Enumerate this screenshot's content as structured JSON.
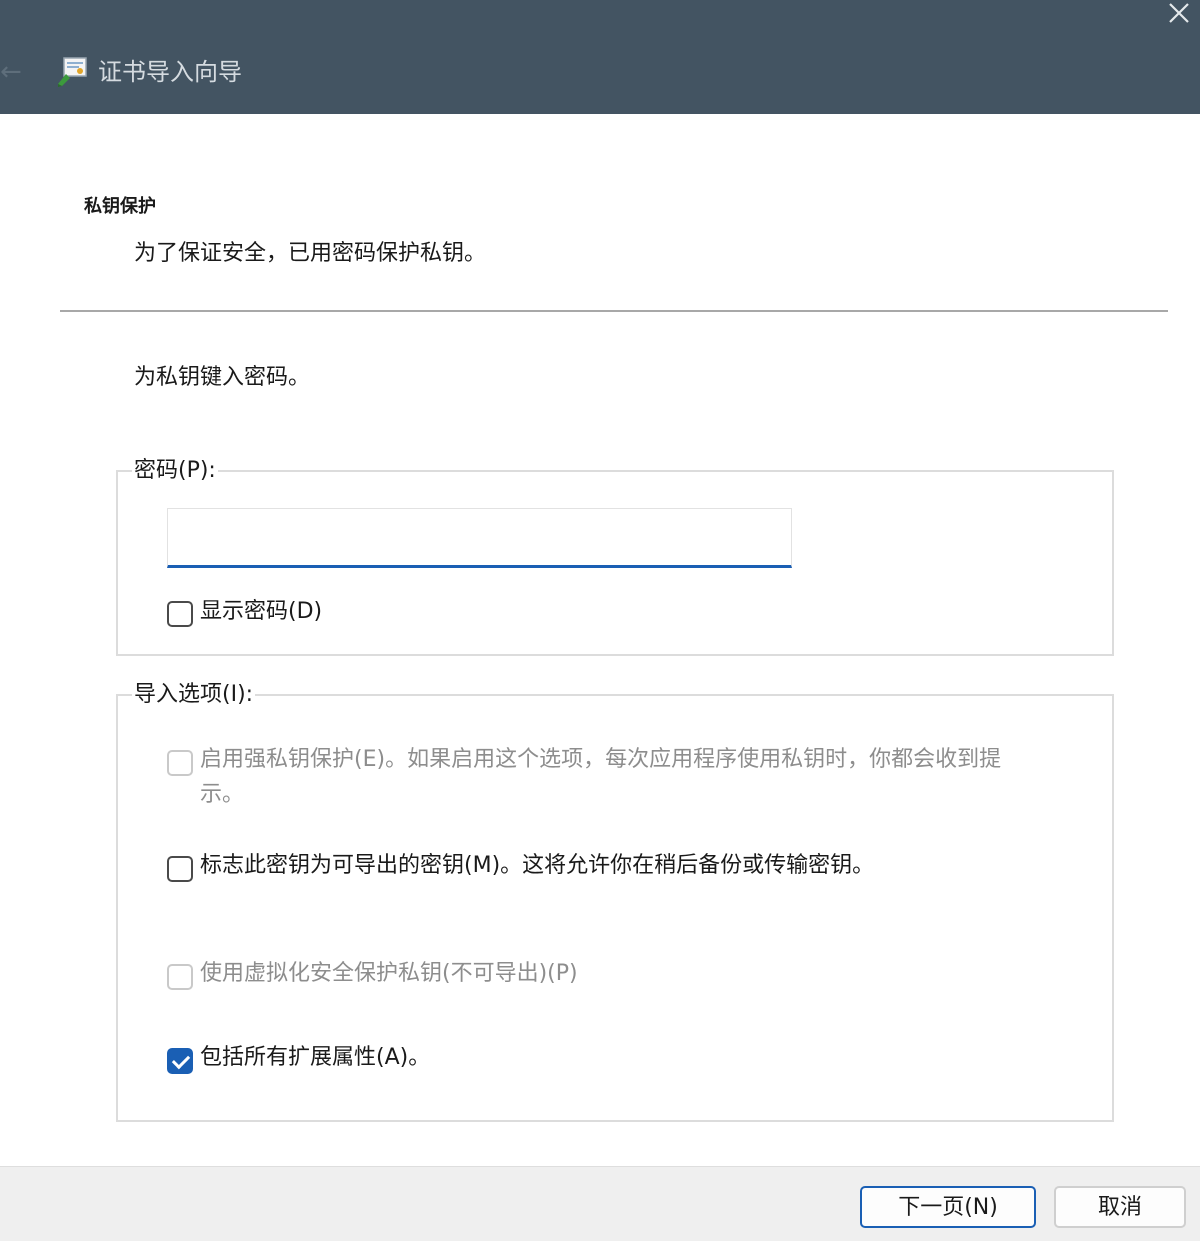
{
  "window": {
    "title": "证书导入向导",
    "back_icon": "back-arrow-icon",
    "close_icon": "close-icon",
    "app_icon": "certificate-wizard-icon"
  },
  "header": {
    "section_title": "私钥保护",
    "section_desc": "为了保证安全，已用密码保护私钥。"
  },
  "main": {
    "prompt": "为私钥键入密码。",
    "password_group": {
      "legend": "密码(P):",
      "password_value": "",
      "show_password": {
        "label": "显示密码(D)",
        "checked": false
      }
    },
    "options_group": {
      "legend": "导入选项(I):",
      "options": [
        {
          "label_line1": "启用强私钥保护(E)。如果启用这个选项，每次应用程序使用私钥时，你都会收到提",
          "label_line2": "示。",
          "checked": false,
          "enabled": false
        },
        {
          "label": "标志此密钥为可导出的密钥(M)。这将允许你在稍后备份或传输密钥。",
          "checked": false,
          "enabled": true
        },
        {
          "label": "使用虚拟化安全保护私钥(不可导出)(P)",
          "checked": false,
          "enabled": false
        },
        {
          "label": "包括所有扩展属性(A)。",
          "checked": true,
          "enabled": true
        }
      ]
    }
  },
  "footer": {
    "next_label": "下一页(N)",
    "cancel_label": "取消"
  },
  "colors": {
    "titlebar": "#435462",
    "accent": "#1a5fb4",
    "footer": "#efefef"
  }
}
